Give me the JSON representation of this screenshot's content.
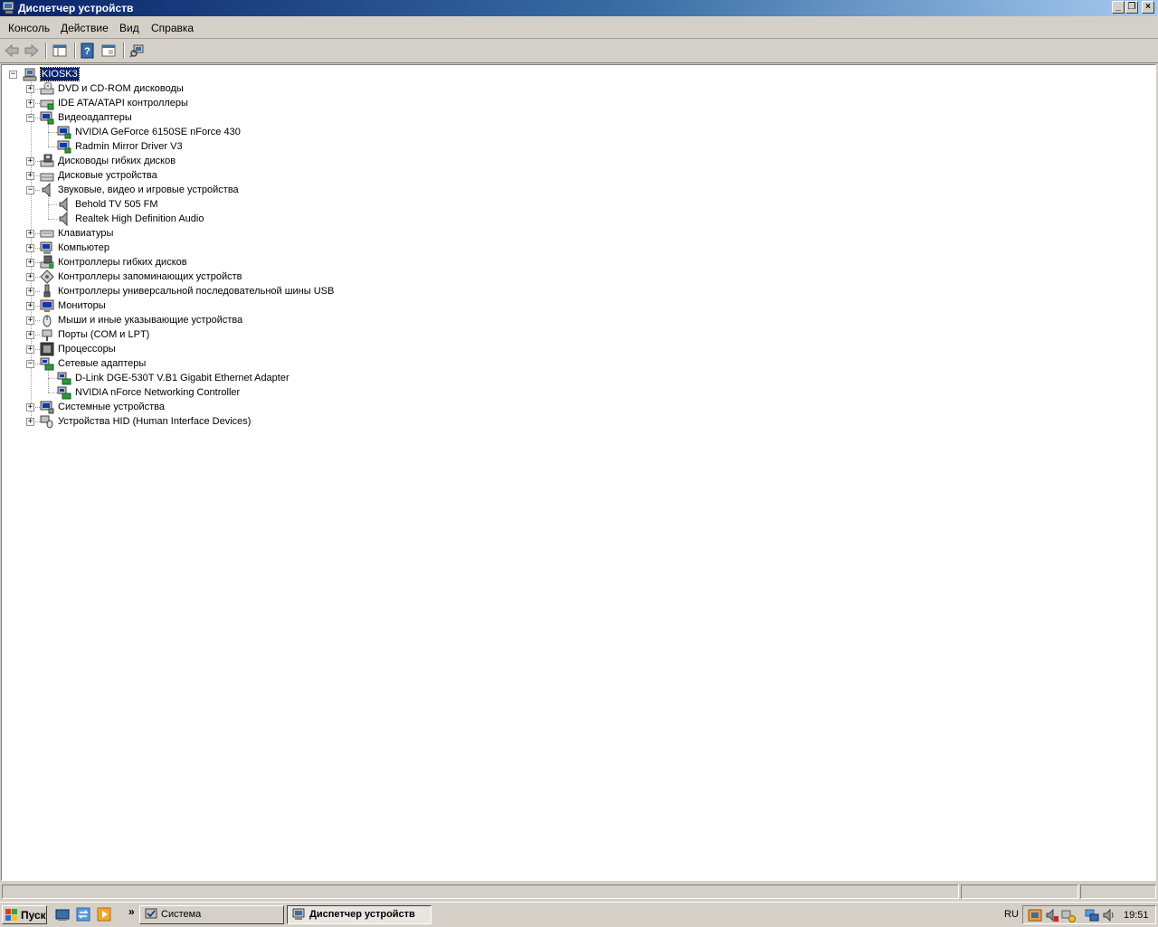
{
  "window": {
    "title": "Диспетчер устройств"
  },
  "menu": [
    "Консоль",
    "Действие",
    "Вид",
    "Справка"
  ],
  "tree": {
    "root": "KIOSK3",
    "categories": [
      {
        "label": "DVD и CD-ROM дисководы",
        "expanded": false,
        "icon": "dvd-drive-icon"
      },
      {
        "label": "IDE ATA/ATAPI контроллеры",
        "expanded": false,
        "icon": "ide-controller-icon"
      },
      {
        "label": "Видеоадаптеры",
        "expanded": true,
        "icon": "display-adapter-icon",
        "children": [
          "NVIDIA GeForce 6150SE nForce 430",
          "Radmin Mirror Driver V3"
        ]
      },
      {
        "label": "Дисководы гибких дисков",
        "expanded": false,
        "icon": "floppy-drive-icon"
      },
      {
        "label": "Дисковые устройства",
        "expanded": false,
        "icon": "disk-drive-icon"
      },
      {
        "label": "Звуковые, видео и игровые устройства",
        "expanded": true,
        "icon": "speaker-icon",
        "children": [
          "Behold TV 505 FM",
          "Realtek High Definition Audio"
        ]
      },
      {
        "label": "Клавиатуры",
        "expanded": false,
        "icon": "keyboard-icon"
      },
      {
        "label": "Компьютер",
        "expanded": false,
        "icon": "computer-icon"
      },
      {
        "label": "Контроллеры гибких дисков",
        "expanded": false,
        "icon": "floppy-controller-icon"
      },
      {
        "label": "Контроллеры запоминающих устройств",
        "expanded": false,
        "icon": "storage-controller-icon"
      },
      {
        "label": "Контроллеры универсальной последовательной шины USB",
        "expanded": false,
        "icon": "usb-icon"
      },
      {
        "label": "Мониторы",
        "expanded": false,
        "icon": "monitor-icon"
      },
      {
        "label": "Мыши и иные указывающие устройства",
        "expanded": false,
        "icon": "mouse-icon"
      },
      {
        "label": "Порты (COM и LPT)",
        "expanded": false,
        "icon": "port-icon"
      },
      {
        "label": "Процессоры",
        "expanded": false,
        "icon": "processor-icon"
      },
      {
        "label": "Сетевые адаптеры",
        "expanded": true,
        "icon": "network-adapter-icon",
        "children": [
          "D-Link DGE-530T V.B1 Gigabit Ethernet Adapter",
          "NVIDIA nForce Networking Controller"
        ]
      },
      {
        "label": "Системные устройства",
        "expanded": false,
        "icon": "system-device-icon"
      },
      {
        "label": "Устройства HID (Human Interface Devices)",
        "expanded": false,
        "icon": "hid-icon"
      }
    ]
  },
  "taskbar": {
    "start_label": "Пуск",
    "overflow": "»",
    "buttons": [
      "Система",
      "Диспетчер устройств"
    ],
    "lang": "RU",
    "clock": "19:51"
  },
  "colors": {
    "title_start": "#0a246a",
    "title_end": "#a6caf0",
    "selection": "#0a246a",
    "face": "#d4d0c8"
  }
}
